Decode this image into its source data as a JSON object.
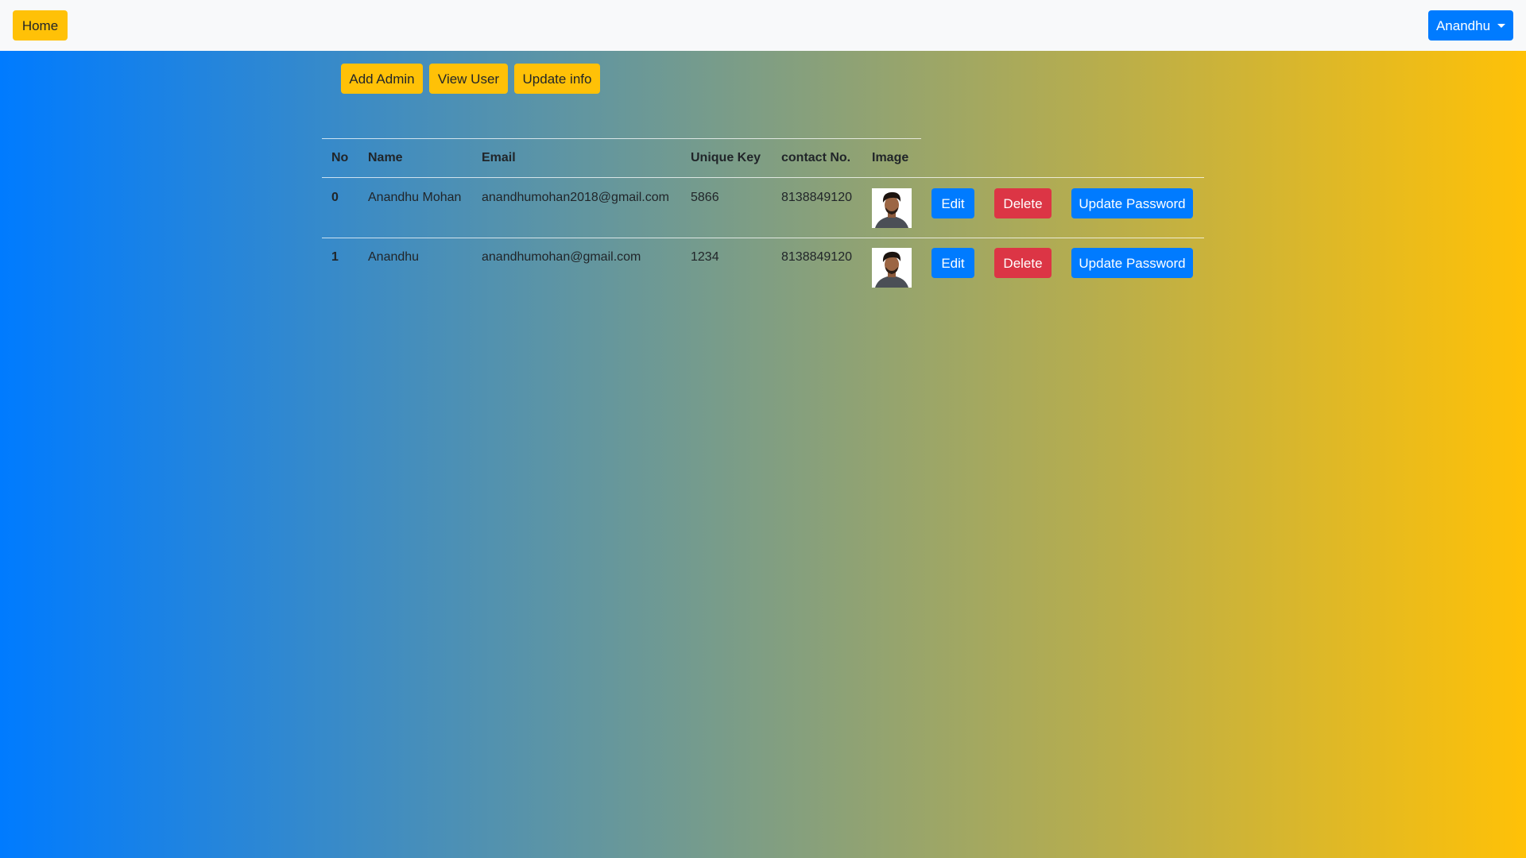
{
  "navbar": {
    "home_label": "Home",
    "user_menu_label": "Anandhu"
  },
  "actions": {
    "add_admin": "Add Admin",
    "view_user": "View User",
    "update_info": "Update info"
  },
  "table": {
    "headers": [
      "No",
      "Name",
      "Email",
      "Unique Key",
      "contact No.",
      "Image"
    ],
    "rows": [
      {
        "no": "0",
        "name": "Anandhu Mohan",
        "email": "anandhumohan2018@gmail.com",
        "unique_key": "5866",
        "contact": "8138849120",
        "image": "person-photo",
        "edit": "Edit",
        "delete": "Delete",
        "update_password": "Update Password"
      },
      {
        "no": "1",
        "name": "Anandhu",
        "email": "anandhumohan@gmail.com",
        "unique_key": "1234",
        "contact": "8138849120",
        "image": "person-photo",
        "edit": "Edit",
        "delete": "Delete",
        "update_password": "Update Password"
      }
    ]
  },
  "colors": {
    "gradient_start": "#007bff",
    "gradient_end": "#ffc107",
    "warning": "#ffc107",
    "primary": "#007bff",
    "danger": "#dc3545"
  }
}
